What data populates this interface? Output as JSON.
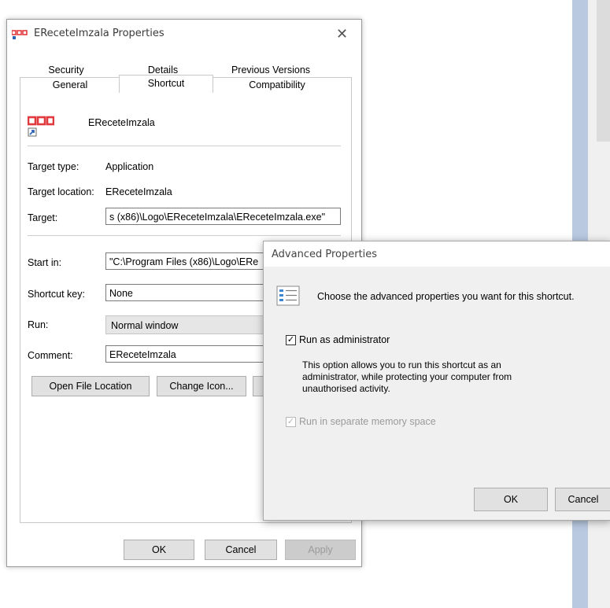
{
  "main_window": {
    "title": "EReceteImzala Properties",
    "close_glyph": "✕",
    "tabs_row1": [
      "Security",
      "Details",
      "Previous Versions"
    ],
    "tabs_row2": [
      "General",
      "Shortcut",
      "Compatibility"
    ],
    "app_name": "EReceteImzala",
    "target_type_label": "Target type:",
    "target_type_value": "Application",
    "target_location_label": "Target location:",
    "target_location_value": "EReceteImzala",
    "target_label": "Target:",
    "target_value": "s (x86)\\Logo\\EReceteImzala\\EReceteImzala.exe\"",
    "start_in_label": "Start in:",
    "start_in_value": "\"C:\\Program Files (x86)\\Logo\\ERe",
    "shortcut_key_label": "Shortcut key:",
    "shortcut_key_value": "None",
    "run_label": "Run:",
    "run_value": "Normal window",
    "comment_label": "Comment:",
    "comment_value": "EReceteImzala",
    "buttons": {
      "open_file_location": "Open File Location",
      "change_icon": "Change Icon...",
      "ok": "OK",
      "cancel": "Cancel",
      "apply": "Apply"
    }
  },
  "advanced_dialog": {
    "title": "Advanced Properties",
    "heading": "Choose the advanced properties you want for this shortcut.",
    "run_as_admin_label": "Run as administrator",
    "run_as_admin_checked": true,
    "description_line1": "This option allows you to run this shortcut as an",
    "description_line2": "administrator, while protecting your computer from",
    "description_line3": "unauthorised activity.",
    "separate_memory_label": "Run in separate memory space",
    "separate_memory_checked": true,
    "check_glyph": "✓",
    "ok": "OK",
    "cancel": "Cancel"
  },
  "colors": {
    "logo_red": "#e0393e",
    "scroll_blue": "#b9c9e0"
  }
}
